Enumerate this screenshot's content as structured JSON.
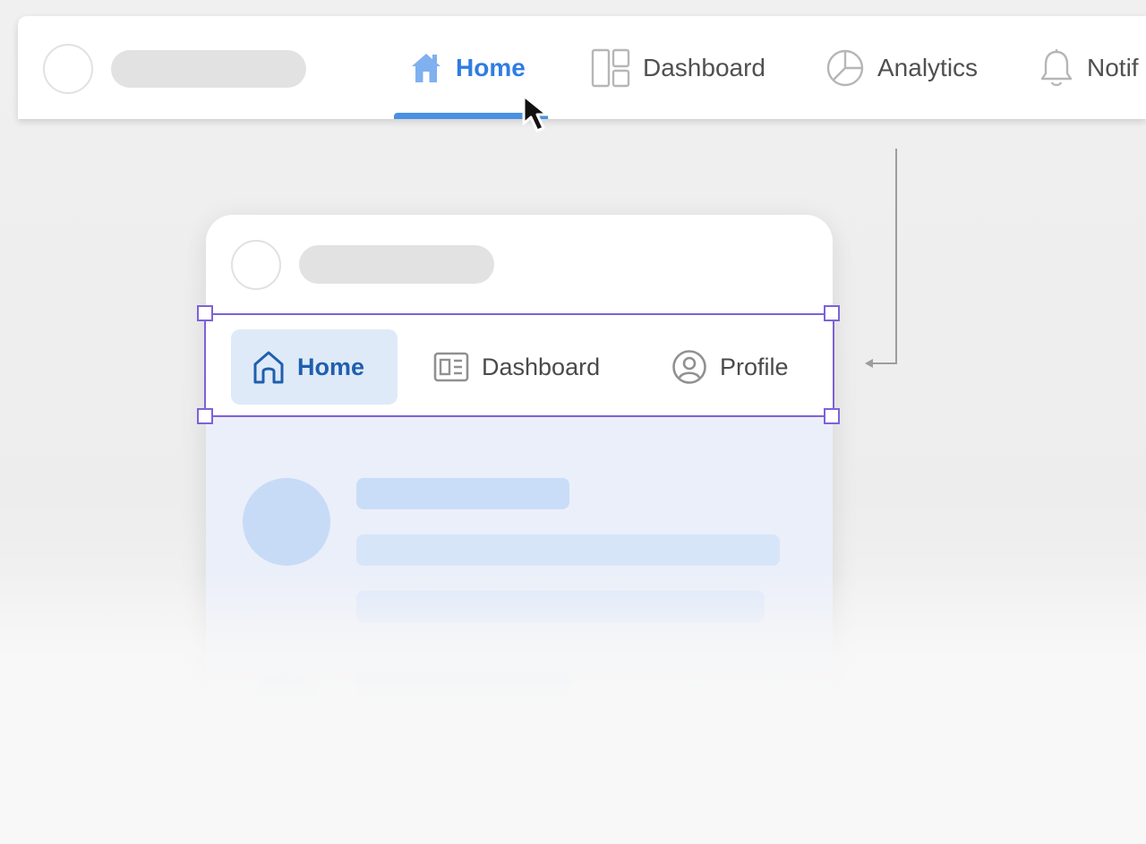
{
  "top_nav": {
    "tabs": [
      {
        "label": "Home",
        "icon": "home-icon",
        "active": true
      },
      {
        "label": "Dashboard",
        "icon": "dashboard-grid-icon",
        "active": false
      },
      {
        "label": "Analytics",
        "icon": "pie-chart-icon",
        "active": false
      },
      {
        "label": "Notif",
        "icon": "bell-icon",
        "active": false
      }
    ]
  },
  "inner_nav": {
    "tabs": [
      {
        "label": "Home",
        "icon": "home-icon",
        "active": true
      },
      {
        "label": "Dashboard",
        "icon": "id-card-icon",
        "active": false
      },
      {
        "label": "Profile",
        "icon": "user-circle-icon",
        "active": false
      }
    ]
  },
  "colors": {
    "accent": "#2f7de1",
    "active_tab_background": "#dfeaf8",
    "selection_outline": "#7d62d9",
    "skeleton": "#c9ddf8"
  }
}
